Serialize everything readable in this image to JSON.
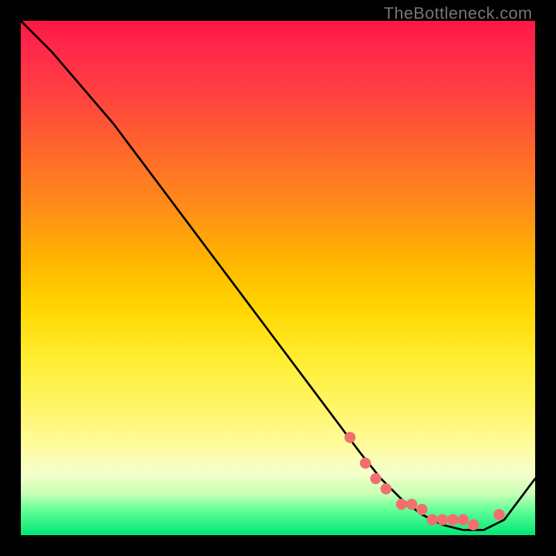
{
  "watermark": "TheBottleneck.com",
  "chart_data": {
    "type": "line",
    "title": "",
    "xlabel": "",
    "ylabel": "",
    "xlim": [
      0,
      100
    ],
    "ylim": [
      0,
      100
    ],
    "grid": false,
    "legend": false,
    "series": [
      {
        "name": "curve",
        "x": [
          0,
          6,
          12,
          18,
          24,
          30,
          36,
          42,
          48,
          54,
          60,
          66,
          70,
          74,
          78,
          82,
          86,
          90,
          94,
          100
        ],
        "y": [
          100,
          94,
          87,
          80,
          72,
          64,
          56,
          48,
          40,
          32,
          24,
          16,
          11,
          7,
          4,
          2,
          1,
          1,
          3,
          11
        ]
      }
    ],
    "markers": {
      "name": "dots",
      "x": [
        64,
        67,
        69,
        71,
        74,
        76,
        78,
        80,
        82,
        84,
        86,
        88,
        93
      ],
      "y": [
        19,
        14,
        11,
        9,
        6,
        6,
        5,
        3,
        3,
        3,
        3,
        2,
        4
      ]
    },
    "colors": {
      "line": "#000000",
      "marker": "#f36f6f"
    }
  }
}
